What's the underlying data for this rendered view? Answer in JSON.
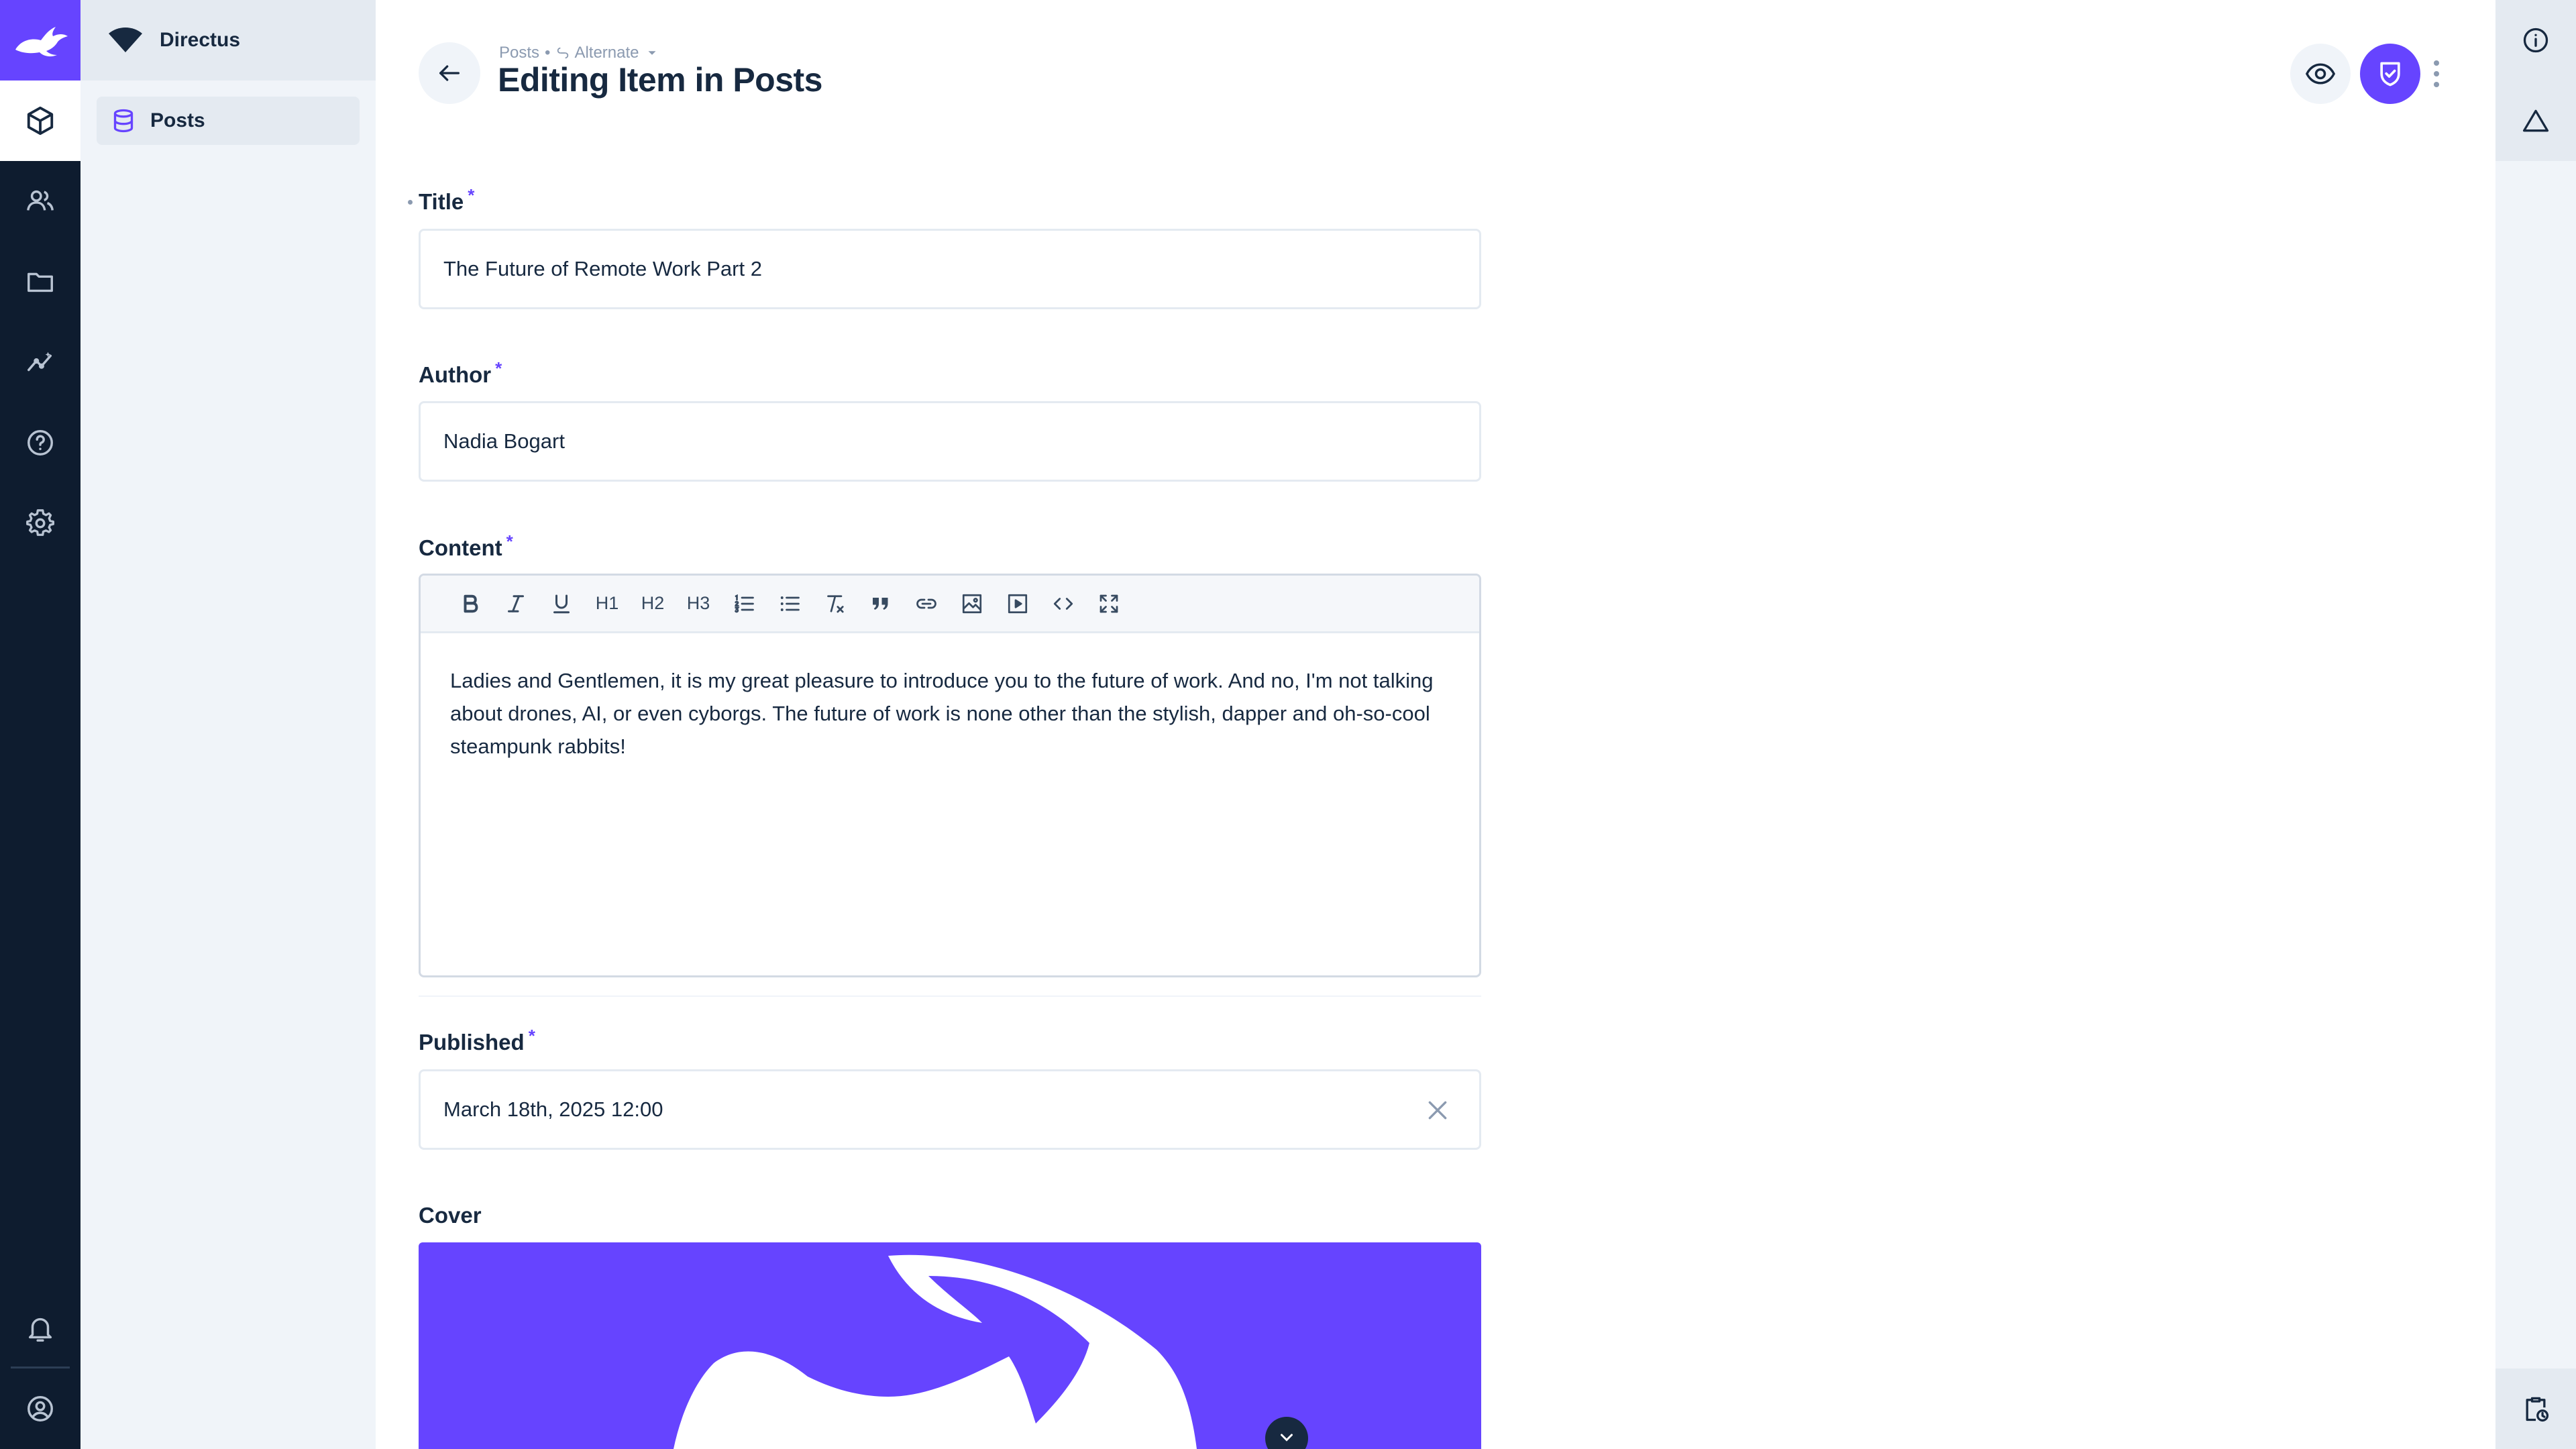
{
  "project": {
    "name": "Directus"
  },
  "navigation": {
    "items": [
      {
        "label": "Posts",
        "icon": "database-icon"
      }
    ]
  },
  "modules": [
    {
      "name": "content",
      "icon": "cube-icon",
      "active": true
    },
    {
      "name": "users",
      "icon": "users-icon",
      "active": false
    },
    {
      "name": "files",
      "icon": "folder-icon",
      "active": false
    },
    {
      "name": "insights",
      "icon": "insights-icon",
      "active": false
    },
    {
      "name": "help",
      "icon": "help-icon",
      "active": false
    },
    {
      "name": "settings",
      "icon": "gear-icon",
      "active": false
    },
    {
      "name": "notifications",
      "icon": "bell-icon",
      "active": false
    },
    {
      "name": "user-menu",
      "icon": "account-icon",
      "active": false
    }
  ],
  "header": {
    "breadcrumb": {
      "collection": "Posts",
      "separator": "•",
      "version": "Alternate"
    },
    "title": "Editing Item in Posts"
  },
  "colors": {
    "accent": "#6644ff",
    "module_bar": "#0e1c2f",
    "nav_bg": "#f0f4f9",
    "text": "#172940"
  },
  "form": {
    "required_marker": "*",
    "title": {
      "label": "Title",
      "value": "The Future of Remote Work Part 2"
    },
    "author": {
      "label": "Author",
      "value": "Nadia Bogart"
    },
    "content": {
      "label": "Content",
      "toolbar": {
        "h1": "H1",
        "h2": "H2",
        "h3": "H3"
      },
      "value": "Ladies and Gentlemen, it is my great pleasure to introduce you to the future of work. And no, I'm not talking about drones, AI, or even cyborgs. The future of work is none other than the stylish, dapper and oh-so-cool steampunk rabbits!"
    },
    "published": {
      "label": "Published",
      "value": "March 18th, 2025 12:00"
    },
    "cover": {
      "label": "Cover"
    }
  }
}
